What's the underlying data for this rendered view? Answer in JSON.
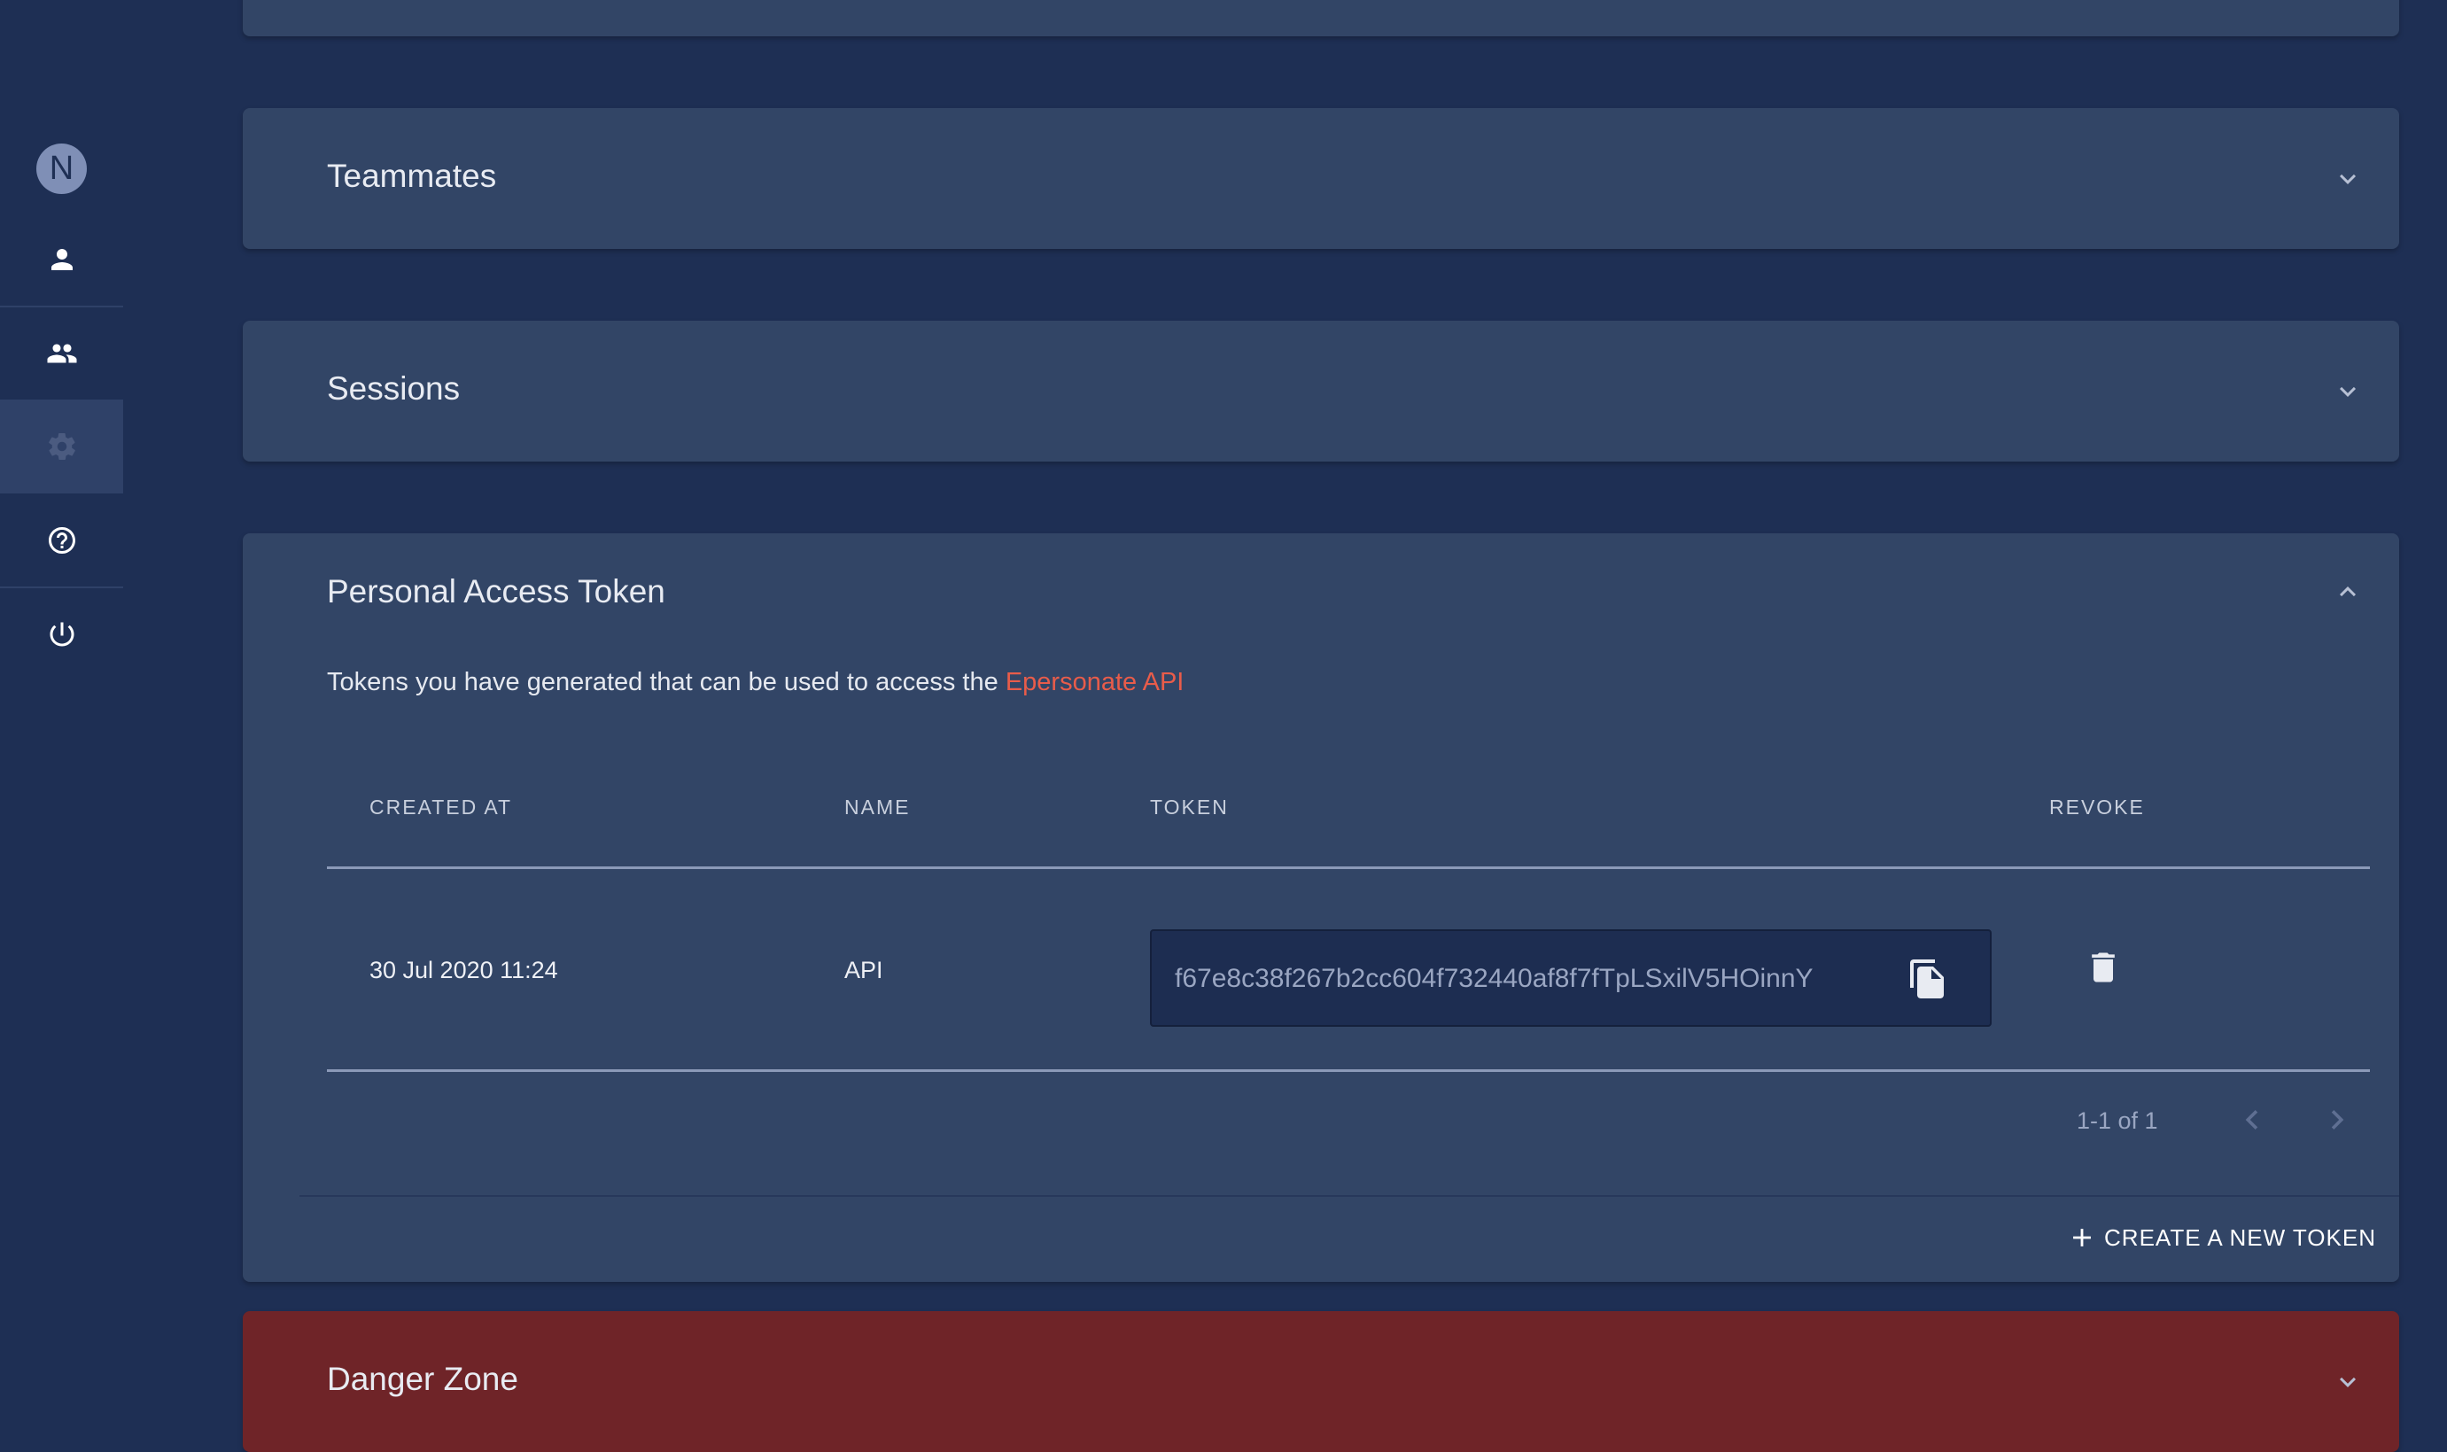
{
  "sidebar": {
    "avatar_initial": "N",
    "items": [
      {
        "icon": "person-icon",
        "label": "Profile"
      },
      {
        "icon": "group-icon",
        "label": "Team"
      },
      {
        "icon": "gear-icon",
        "label": "Settings",
        "active": true
      },
      {
        "icon": "help-icon",
        "label": "Help"
      },
      {
        "icon": "power-icon",
        "label": "Log out"
      }
    ]
  },
  "panels": {
    "teammates": {
      "title": "Teammates",
      "expanded": false
    },
    "sessions": {
      "title": "Sessions",
      "expanded": false
    },
    "pat": {
      "title": "Personal Access Token",
      "expanded": true,
      "description": "Tokens you have generated that can be used to access the",
      "link_text": "Epersonate API",
      "table": {
        "headers": [
          "CREATED AT",
          "NAME",
          "TOKEN",
          "REVOKE"
        ],
        "rows": [
          {
            "created_at": "30 Jul 2020 11:24",
            "name": "API",
            "token": "f67e8c38f267b2cc604f732440af8f7fTpLSxilV5HOinnY"
          }
        ]
      },
      "pagination": "1-1 of 1",
      "create_button": "CREATE A NEW TOKEN"
    },
    "danger": {
      "title": "Danger Zone",
      "expanded": false
    }
  },
  "colors": {
    "background": "#1e2f54",
    "panel": "#324566",
    "danger": "#6f2428",
    "link": "#e85c4a"
  }
}
